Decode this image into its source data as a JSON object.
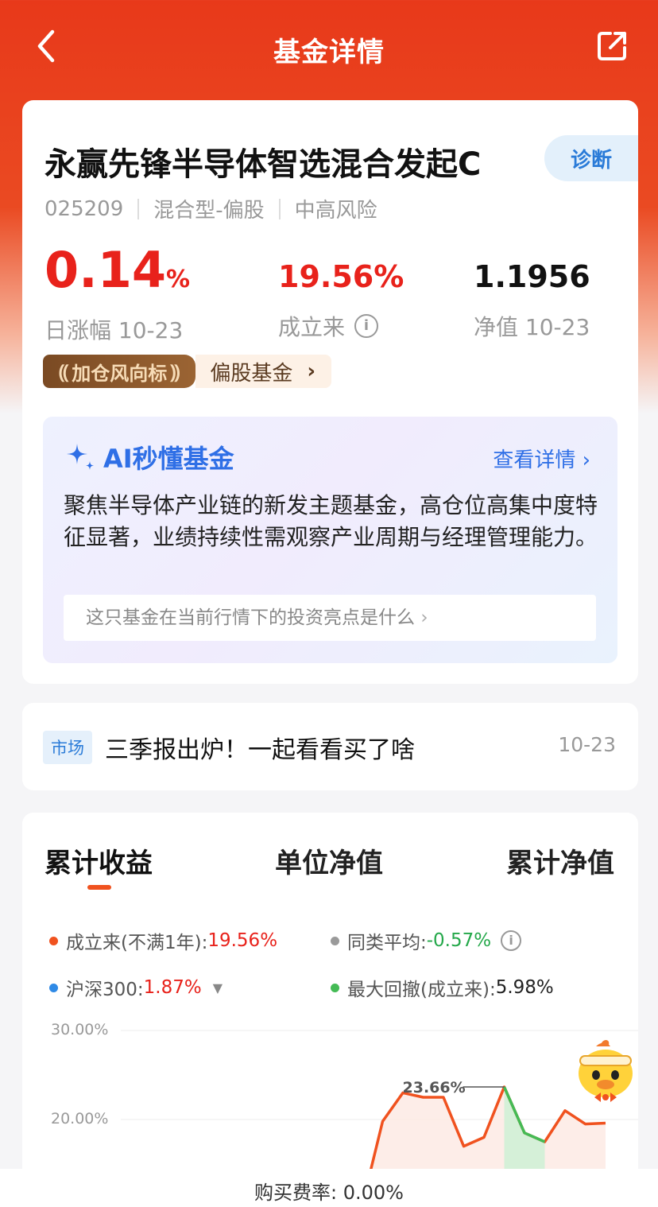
{
  "header": {
    "title": "基金详情"
  },
  "fund": {
    "name": "永赢先锋半导体智选混合发起C",
    "diagnose_label": "诊断",
    "code": "025209",
    "category": "混合型-偏股",
    "risk": "中高风险",
    "daily_change": {
      "value": "0.14",
      "unit": "%",
      "label": "日涨幅 10-23"
    },
    "since_inception": {
      "value": "19.56%",
      "label": "成立来"
    },
    "nav": {
      "value": "1.1956",
      "label": "净值 10-23"
    },
    "tag_dark": "加仓风向标",
    "tag_light": "偏股基金"
  },
  "ai": {
    "title": "AI秒懂基金",
    "more_label": "查看详情",
    "summary": "聚焦半导体产业链的新发主题基金，高仓位高集中度特征显著，业绩持续性需观察产业周期与经理管理能力。",
    "question": "这只基金在当前行情下的投资亮点是什么"
  },
  "news": {
    "tag": "市场",
    "title": "三季报出炉！一起看看买了啥",
    "date": "10-23"
  },
  "chart_tabs": [
    "累计收益",
    "单位净值",
    "累计净值"
  ],
  "legend": {
    "inception": {
      "label": "成立来(不满1年):",
      "value": "19.56%",
      "color": "#f0521f"
    },
    "peer_avg": {
      "label": "同类平均:",
      "value": "-0.57%",
      "color": "#9a9a9a"
    },
    "hs300": {
      "label": "沪深300:",
      "value": "1.87%",
      "color": "#2f8ae6"
    },
    "max_drawdown": {
      "label": "最大回撤(成立来):",
      "value": "5.98%",
      "color": "#44bb55"
    }
  },
  "chart_data": {
    "type": "area",
    "y_ticks": [
      "30.00%",
      "20.00%"
    ],
    "ylim": [
      10,
      30
    ],
    "peak_label": "23.66%",
    "series": [
      {
        "color": "#f0521f",
        "values": [
          10.5,
          19.8,
          23.0,
          22.5,
          22.5,
          17.0,
          18.0,
          23.66,
          18.5,
          17.5,
          21.0,
          19.5,
          19.6
        ]
      }
    ],
    "drawdown_range": [
      7,
      9
    ]
  },
  "bottom": {
    "fee_text": "购买费率: 0.00%"
  }
}
